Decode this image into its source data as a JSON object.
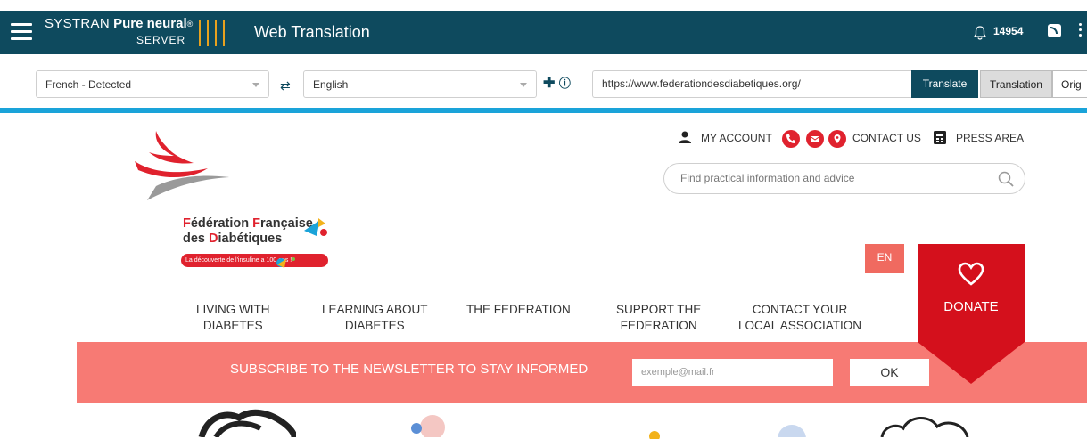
{
  "app": {
    "brand_systran": "SYSTRAN",
    "brand_pure": "Pure neural",
    "brand_reg": "®",
    "brand_server": "SERVER",
    "title": "Web Translation",
    "notification_count": "14954"
  },
  "toolbar": {
    "source_language": "French - Detected",
    "target_language": "English",
    "url_value": "https://www.federationdesdiabetiques.org/",
    "translate_label": "Translate",
    "translation_label": "Translation",
    "original_label": "Orig"
  },
  "site": {
    "logo": {
      "line1_prefix": "F",
      "line1_rest": "édération ",
      "line1_f2": "F",
      "line1_rest2": "rançaise",
      "line2_prefix": "des ",
      "line2_d": "D",
      "line2_rest": "iabétiques",
      "tagline": "La découverte de l'insuline a 100 ans !"
    },
    "top_nav": {
      "my_account": "MY ACCOUNT",
      "contact_us": "CONTACT US",
      "press_area": "PRESS AREA"
    },
    "search_placeholder": "Find practical information and advice",
    "lang_button": "EN",
    "donate_label": "DONATE",
    "main_nav": [
      {
        "line1": "LIVING WITH",
        "line2": "DIABETES"
      },
      {
        "line1": "LEARNING ABOUT",
        "line2": "DIABETES"
      },
      {
        "line1": "THE FEDERATION",
        "line2": ""
      },
      {
        "line1": "SUPPORT THE",
        "line2": "FEDERATION"
      },
      {
        "line1": "CONTACT YOUR",
        "line2": "LOCAL ASSOCIATION"
      }
    ],
    "newsletter": {
      "text": "SUBSCRIBE TO THE NEWSLETTER TO STAY INFORMED",
      "placeholder": "exemple@mail.fr",
      "ok_label": "OK"
    }
  },
  "colors": {
    "header_bg": "#0e4a5e",
    "accent_cyan": "#1aa3d9",
    "brand_red": "#e0222e",
    "salmon": "#f77a74"
  }
}
